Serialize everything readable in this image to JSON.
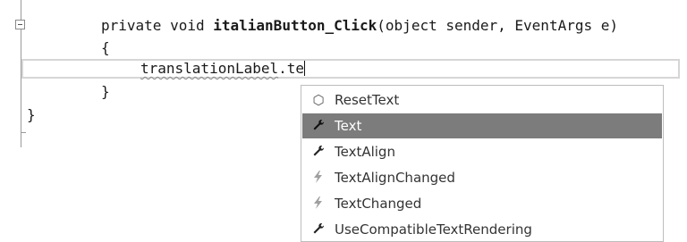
{
  "editor": {
    "lines": [
      {
        "kw1": "private",
        "kw2": "void",
        "method": "italianButton_Click",
        "params": "(object sender, EventArgs e)"
      },
      {
        "text": "{"
      },
      {
        "object": "translationLabel",
        "rest": ".te"
      },
      {
        "text": "}"
      },
      {
        "text": "}"
      }
    ]
  },
  "intellisense": {
    "items": [
      {
        "label": "ResetText",
        "icon": "method-cube-icon",
        "selected": false
      },
      {
        "label": "Text",
        "icon": "property-wrench-icon",
        "selected": true
      },
      {
        "label": "TextAlign",
        "icon": "property-wrench-icon",
        "selected": false
      },
      {
        "label": "TextAlignChanged",
        "icon": "event-lightning-icon",
        "selected": false
      },
      {
        "label": "TextChanged",
        "icon": "event-lightning-icon",
        "selected": false
      },
      {
        "label": "UseCompatibleTextRendering",
        "icon": "property-wrench-icon",
        "selected": false
      }
    ]
  },
  "colors": {
    "selection": "#7c7c7c",
    "current_line_border": "#d6d6d6"
  }
}
